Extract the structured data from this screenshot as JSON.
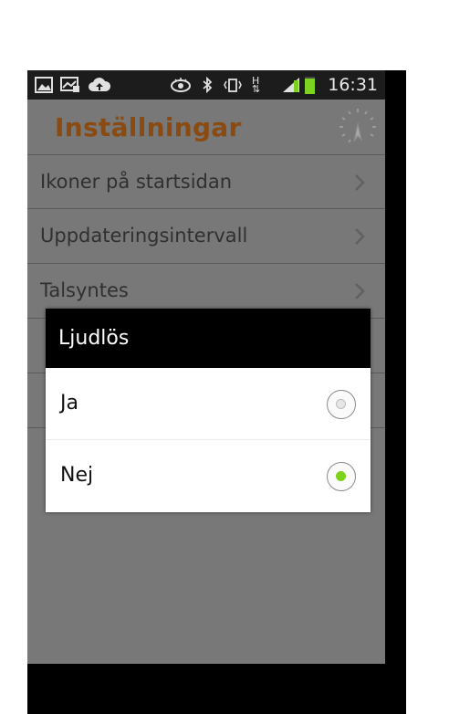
{
  "statusbar": {
    "time": "16:31",
    "icons": [
      "gallery-icon",
      "message-icon",
      "cloud-upload-icon",
      "eye-icon",
      "bluetooth-icon",
      "vibrate-icon",
      "hspa-icon",
      "signal-icon",
      "battery-icon"
    ],
    "hspa_label": "H"
  },
  "app": {
    "title": "Inställningar"
  },
  "settings": {
    "items": [
      {
        "label": "Ikoner på startsidan"
      },
      {
        "label": "Uppdateringsintervall"
      },
      {
        "label": "Talsyntes"
      },
      {
        "label": ""
      },
      {
        "label": ""
      }
    ]
  },
  "dialog": {
    "title": "Ljudlös",
    "options": [
      {
        "label": "Ja",
        "selected": false
      },
      {
        "label": "Nej",
        "selected": true
      }
    ]
  },
  "colors": {
    "accent": "#7cd31a",
    "title": "#8a4a10",
    "dim_background": "#787878"
  }
}
